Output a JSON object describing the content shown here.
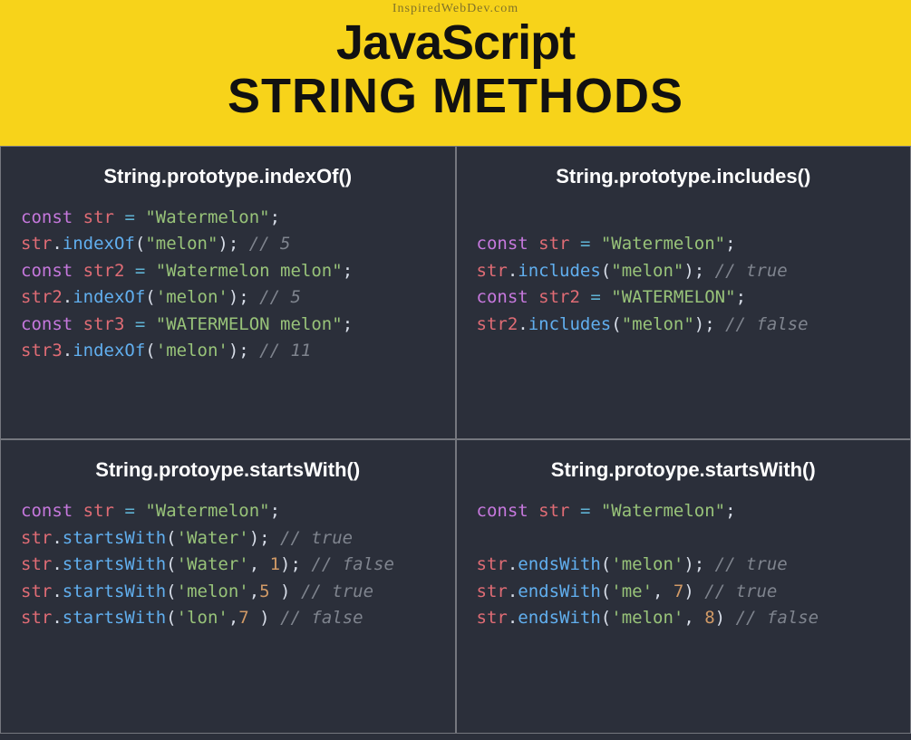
{
  "header": {
    "source": "InspiredWebDev.com",
    "title1": "JavaScript",
    "title2": "STRING METHODS"
  },
  "cells": [
    {
      "title": "String.prototype.indexOf()",
      "lines": [
        [
          [
            "kw",
            "const"
          ],
          [
            "pn",
            " "
          ],
          [
            "var",
            "str"
          ],
          [
            "pn",
            " "
          ],
          [
            "op",
            "="
          ],
          [
            "pn",
            " "
          ],
          [
            "str",
            "\"Watermelon\""
          ],
          [
            "pn",
            ";"
          ]
        ],
        [
          [
            "var",
            "str"
          ],
          [
            "pn",
            "."
          ],
          [
            "fn",
            "indexOf"
          ],
          [
            "pn",
            "("
          ],
          [
            "str",
            "\"melon\""
          ],
          [
            "pn",
            ");"
          ],
          [
            "pn",
            " "
          ],
          [
            "cm",
            "// 5"
          ]
        ],
        [
          [
            "kw",
            "const"
          ],
          [
            "pn",
            " "
          ],
          [
            "var",
            "str2"
          ],
          [
            "pn",
            " "
          ],
          [
            "op",
            "="
          ],
          [
            "pn",
            " "
          ],
          [
            "str",
            "\"Watermelon melon\""
          ],
          [
            "pn",
            ";"
          ]
        ],
        [
          [
            "var",
            "str2"
          ],
          [
            "pn",
            "."
          ],
          [
            "fn",
            "indexOf"
          ],
          [
            "pn",
            "("
          ],
          [
            "str",
            "'melon'"
          ],
          [
            "pn",
            ");"
          ],
          [
            "pn",
            " "
          ],
          [
            "cm",
            "// 5"
          ]
        ],
        [
          [
            "kw",
            "const"
          ],
          [
            "pn",
            " "
          ],
          [
            "var",
            "str3"
          ],
          [
            "pn",
            " "
          ],
          [
            "op",
            "="
          ],
          [
            "pn",
            " "
          ],
          [
            "str",
            "\"WATERMELON melon\""
          ],
          [
            "pn",
            ";"
          ]
        ],
        [
          [
            "var",
            "str3"
          ],
          [
            "pn",
            "."
          ],
          [
            "fn",
            "indexOf"
          ],
          [
            "pn",
            "("
          ],
          [
            "str",
            "'melon'"
          ],
          [
            "pn",
            ");"
          ],
          [
            "pn",
            " "
          ],
          [
            "cm",
            "// 11"
          ]
        ]
      ]
    },
    {
      "title": "String.prototype.includes()",
      "lines": [
        [
          [
            "pn",
            " "
          ]
        ],
        [
          [
            "kw",
            "const"
          ],
          [
            "pn",
            " "
          ],
          [
            "var",
            "str"
          ],
          [
            "pn",
            " "
          ],
          [
            "op",
            "="
          ],
          [
            "pn",
            " "
          ],
          [
            "str",
            "\"Watermelon\""
          ],
          [
            "pn",
            ";"
          ]
        ],
        [
          [
            "var",
            "str"
          ],
          [
            "pn",
            "."
          ],
          [
            "fn",
            "includes"
          ],
          [
            "pn",
            "("
          ],
          [
            "str",
            "\"melon\""
          ],
          [
            "pn",
            ");"
          ],
          [
            "pn",
            " "
          ],
          [
            "cm",
            "// true"
          ]
        ],
        [
          [
            "kw",
            "const"
          ],
          [
            "pn",
            " "
          ],
          [
            "var",
            "str2"
          ],
          [
            "pn",
            " "
          ],
          [
            "op",
            "="
          ],
          [
            "pn",
            " "
          ],
          [
            "str",
            "\"WATERMELON\""
          ],
          [
            "pn",
            ";"
          ]
        ],
        [
          [
            "var",
            "str2"
          ],
          [
            "pn",
            "."
          ],
          [
            "fn",
            "includes"
          ],
          [
            "pn",
            "("
          ],
          [
            "str",
            "\"melon\""
          ],
          [
            "pn",
            ");"
          ],
          [
            "pn",
            " "
          ],
          [
            "cm",
            "// false"
          ]
        ]
      ]
    },
    {
      "title": "String.protoype.startsWith()",
      "lines": [
        [
          [
            "kw",
            "const"
          ],
          [
            "pn",
            " "
          ],
          [
            "var",
            "str"
          ],
          [
            "pn",
            " "
          ],
          [
            "op",
            "="
          ],
          [
            "pn",
            " "
          ],
          [
            "str",
            "\"Watermelon\""
          ],
          [
            "pn",
            ";"
          ]
        ],
        [
          [
            "var",
            "str"
          ],
          [
            "pn",
            "."
          ],
          [
            "fn",
            "startsWith"
          ],
          [
            "pn",
            "("
          ],
          [
            "str",
            "'Water'"
          ],
          [
            "pn",
            ");"
          ],
          [
            "pn",
            " "
          ],
          [
            "cm",
            "// true"
          ]
        ],
        [
          [
            "var",
            "str"
          ],
          [
            "pn",
            "."
          ],
          [
            "fn",
            "startsWith"
          ],
          [
            "pn",
            "("
          ],
          [
            "str",
            "'Water'"
          ],
          [
            "pn",
            ", "
          ],
          [
            "num",
            "1"
          ],
          [
            "pn",
            ");"
          ],
          [
            "pn",
            " "
          ],
          [
            "cm",
            "// false"
          ]
        ],
        [
          [
            "var",
            "str"
          ],
          [
            "pn",
            "."
          ],
          [
            "fn",
            "startsWith"
          ],
          [
            "pn",
            "("
          ],
          [
            "str",
            "'melon'"
          ],
          [
            "pn",
            ","
          ],
          [
            "num",
            "5"
          ],
          [
            "pn",
            " )"
          ],
          [
            "pn",
            " "
          ],
          [
            "cm",
            "// true"
          ]
        ],
        [
          [
            "var",
            "str"
          ],
          [
            "pn",
            "."
          ],
          [
            "fn",
            "startsWith"
          ],
          [
            "pn",
            "("
          ],
          [
            "str",
            "'lon'"
          ],
          [
            "pn",
            ","
          ],
          [
            "num",
            "7"
          ],
          [
            "pn",
            " )"
          ],
          [
            "pn",
            " "
          ],
          [
            "cm",
            "// false"
          ]
        ]
      ]
    },
    {
      "title": "String.protoype.startsWith()",
      "lines": [
        [
          [
            "kw",
            "const"
          ],
          [
            "pn",
            " "
          ],
          [
            "var",
            "str"
          ],
          [
            "pn",
            " "
          ],
          [
            "op",
            "="
          ],
          [
            "pn",
            " "
          ],
          [
            "str",
            "\"Watermelon\""
          ],
          [
            "pn",
            ";"
          ]
        ],
        [
          [
            "pn",
            " "
          ]
        ],
        [
          [
            "var",
            "str"
          ],
          [
            "pn",
            "."
          ],
          [
            "fn",
            "endsWith"
          ],
          [
            "pn",
            "("
          ],
          [
            "str",
            "'melon'"
          ],
          [
            "pn",
            ");"
          ],
          [
            "pn",
            " "
          ],
          [
            "cm",
            "// true"
          ]
        ],
        [
          [
            "var",
            "str"
          ],
          [
            "pn",
            "."
          ],
          [
            "fn",
            "endsWith"
          ],
          [
            "pn",
            "("
          ],
          [
            "str",
            "'me'"
          ],
          [
            "pn",
            ", "
          ],
          [
            "num",
            "7"
          ],
          [
            "pn",
            ")"
          ],
          [
            "pn",
            " "
          ],
          [
            "cm",
            "// true"
          ]
        ],
        [
          [
            "var",
            "str"
          ],
          [
            "pn",
            "."
          ],
          [
            "fn",
            "endsWith"
          ],
          [
            "pn",
            "("
          ],
          [
            "str",
            "'melon'"
          ],
          [
            "pn",
            ", "
          ],
          [
            "num",
            "8"
          ],
          [
            "pn",
            ")"
          ],
          [
            "pn",
            " "
          ],
          [
            "cm",
            "// false"
          ]
        ]
      ]
    }
  ]
}
